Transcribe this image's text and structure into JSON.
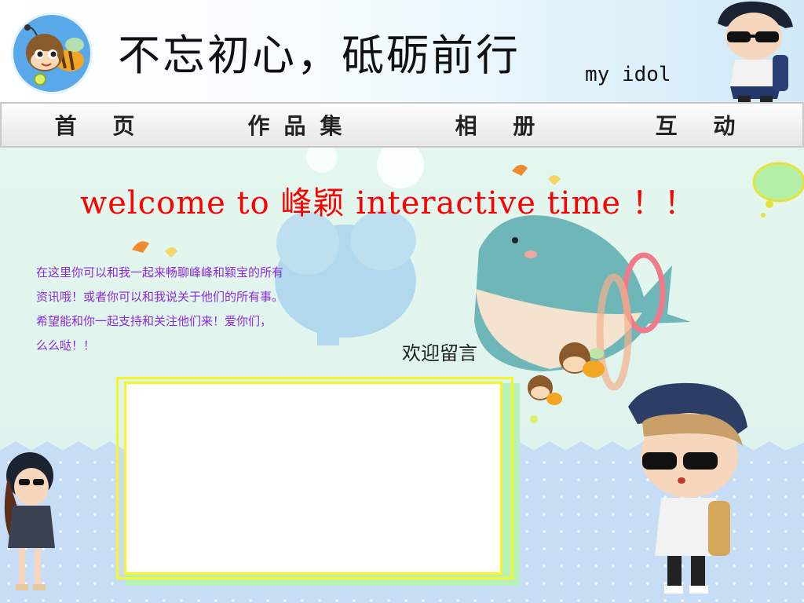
{
  "header": {
    "title": "不忘初心，砥砺前行",
    "subtitle": "my idol"
  },
  "nav": {
    "items": [
      "首 页",
      "作品集",
      "相 册",
      "互 动"
    ]
  },
  "main": {
    "welcome": "welcome to 峰颖 interactive time ！！",
    "intro_lines": [
      "在这里你可以和我一起来畅聊峰峰和颖宝的所有",
      "资讯哦！或者你可以和我说关于他们的所有事。",
      "希望能和你一起支持和关注他们来！爱你们，",
      "么么哒！！"
    ],
    "message_heading": "欢迎留言",
    "message_value": ""
  },
  "colors": {
    "welcome": "#ff0000",
    "intro": "#8a2be2",
    "box_border": "#f5f52a",
    "logo_bg": "#58a8ea"
  }
}
